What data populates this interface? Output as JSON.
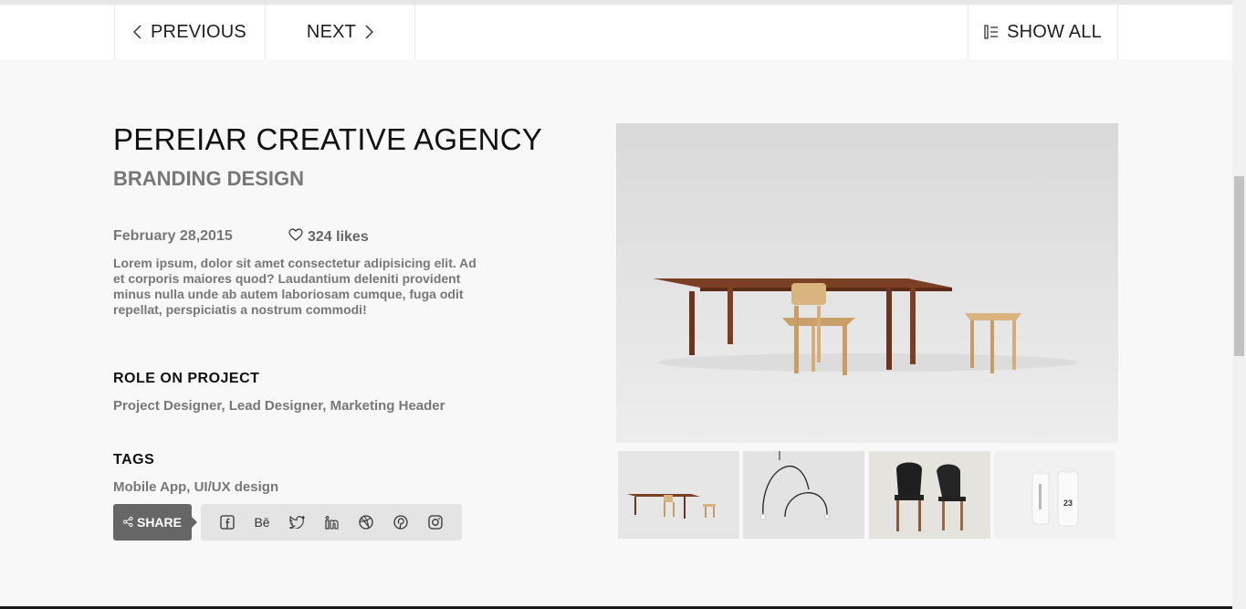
{
  "nav": {
    "previous_label": "PREVIOUS",
    "next_label": "NEXT",
    "show_all_label": "SHOW ALL"
  },
  "project": {
    "title": "PEREIAR CREATIVE AGENCY",
    "subtitle": "BRANDING DESIGN",
    "date": "February 28,2015",
    "likes": "324 likes",
    "description": "Lorem ipsum, dolor sit amet consectetur adipisicing elit. Ad et corporis maiores quod? Laudantium deleniti provident minus nulla unde ab autem laboriosam cumque, fuga odit repellat, perspiciatis a nostrum commodi!",
    "role_heading": "ROLE ON PROJECT",
    "role_text": "Project Designer, Lead Designer, Marketing Header",
    "tags_heading": "TAGS",
    "tags_text": "Mobile App, UI/UX design"
  },
  "share": {
    "label": "SHARE",
    "icons": [
      "facebook-icon",
      "behance-icon",
      "twitter-icon",
      "linkedin-icon",
      "dribbble-icon",
      "pinterest-icon",
      "instagram-icon"
    ],
    "behance_text": "Bē"
  },
  "gallery": {
    "bottle_number": "23"
  },
  "colors": {
    "background": "#f8f8f8",
    "share_button": "#666666",
    "social_bar": "#e4e4e4",
    "muted_text": "#777777"
  }
}
